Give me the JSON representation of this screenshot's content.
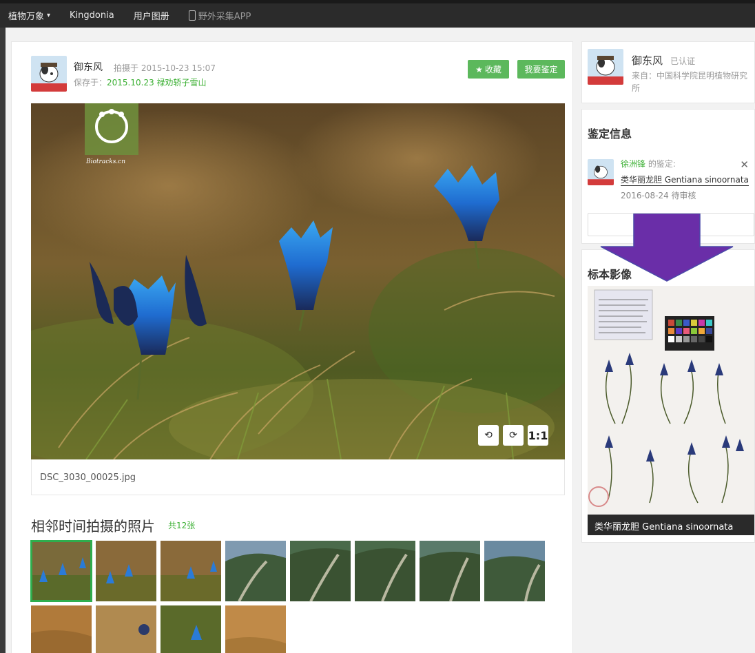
{
  "nav": {
    "brand": "植物万象",
    "items": [
      "Kingdonia",
      "用户图册"
    ],
    "app": "野外采集APP"
  },
  "post": {
    "author": "御东风",
    "taken": "拍摄于 2015-10-23 15:07",
    "saved_prefix": "保存于：",
    "saved_album": "2015.10.23 禄劝轿子雪山",
    "favorite_label": "收藏",
    "identify_label": "我要鉴定",
    "watermark": "Biotracks.cn",
    "filename": "DSC_3030_00025.jpg",
    "tool_ratio": "1:1"
  },
  "nearby": {
    "title": "相邻时间拍摄的照片",
    "count": "共12张"
  },
  "profile": {
    "name": "御东风",
    "verified": "已认证",
    "from": "来自：中国科学院昆明植物研究所"
  },
  "identification": {
    "title": "鉴定信息",
    "user": "徐洲锋",
    "suffix": " 的鉴定:",
    "cn_name": "类华丽龙胆",
    "latin": "Gentiana sinoornata",
    "date_status": "2016-08-24 待审核"
  },
  "specimen": {
    "title": "标本影像",
    "caption": "类华丽龙胆 Gentiana sinoornata"
  },
  "colors": {
    "accent_green": "#5cb85c",
    "link_green": "#3bb033",
    "arrow_purple": "#6a2ea8"
  }
}
